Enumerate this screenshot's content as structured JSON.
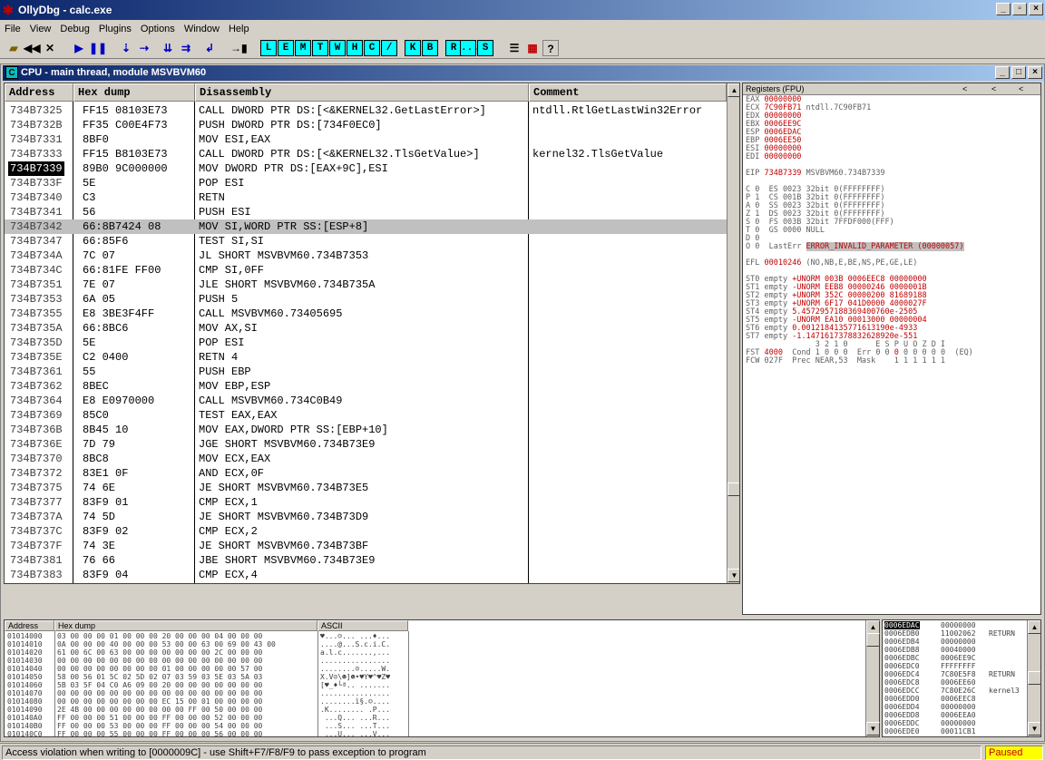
{
  "app": {
    "title": "OllyDbg - calc.exe"
  },
  "menu": [
    "File",
    "View",
    "Debug",
    "Plugins",
    "Options",
    "Window",
    "Help"
  ],
  "toolbar": {
    "letters": [
      "L",
      "E",
      "M",
      "T",
      "W",
      "H",
      "C",
      "/",
      "K",
      "B",
      "R",
      "...",
      "S"
    ]
  },
  "cpu": {
    "title": "CPU - main thread, module MSVBVM60"
  },
  "disasm": {
    "headers": [
      "Address",
      "Hex dump",
      "Disassembly",
      "Comment"
    ],
    "rows": [
      {
        "addr": "734B7325",
        "hex": "FF15 08103E73",
        "dis": "CALL DWORD PTR DS:[<&KERNEL32.GetLastError>]",
        "com": "ntdll.RtlGetLastWin32Error"
      },
      {
        "addr": "734B732B",
        "hex": "FF35 C00E4F73",
        "dis": "PUSH DWORD PTR DS:[734F0EC0]",
        "com": ""
      },
      {
        "addr": "734B7331",
        "hex": "8BF0",
        "dis": "MOV ESI,EAX",
        "com": ""
      },
      {
        "addr": "734B7333",
        "hex": "FF15 B8103E73",
        "dis": "CALL DWORD PTR DS:[<&KERNEL32.TlsGetValue>]",
        "com": "kernel32.TlsGetValue"
      },
      {
        "addr": "734B7339",
        "hex": "89B0 9C000000",
        "dis": "MOV DWORD PTR DS:[EAX+9C],ESI",
        "com": ""
      },
      {
        "addr": "734B733F",
        "hex": "5E",
        "dis": "POP ESI",
        "com": ""
      },
      {
        "addr": "734B7340",
        "hex": "C3",
        "dis": "RETN",
        "com": ""
      },
      {
        "addr": "734B7341",
        "hex": "56",
        "dis": "PUSH ESI",
        "com": ""
      },
      {
        "addr": "734B7342",
        "hex": "66:8B7424 08",
        "dis": "MOV SI,WORD PTR SS:[ESP+8]",
        "com": ""
      },
      {
        "addr": "734B7347",
        "hex": "66:85F6",
        "dis": "TEST SI,SI",
        "com": ""
      },
      {
        "addr": "734B734A",
        "hex": "7C 07",
        "dis": "JL SHORT MSVBVM60.734B7353",
        "com": ""
      },
      {
        "addr": "734B734C",
        "hex": "66:81FE FF00",
        "dis": "CMP SI,0FF",
        "com": ""
      },
      {
        "addr": "734B7351",
        "hex": "7E 07",
        "dis": "JLE SHORT MSVBVM60.734B735A",
        "com": ""
      },
      {
        "addr": "734B7353",
        "hex": "6A 05",
        "dis": "PUSH 5",
        "com": ""
      },
      {
        "addr": "734B7355",
        "hex": "E8 3BE3F4FF",
        "dis": "CALL MSVBVM60.73405695",
        "com": ""
      },
      {
        "addr": "734B735A",
        "hex": "66:8BC6",
        "dis": "MOV AX,SI",
        "com": ""
      },
      {
        "addr": "734B735D",
        "hex": "5E",
        "dis": "POP ESI",
        "com": ""
      },
      {
        "addr": "734B735E",
        "hex": "C2 0400",
        "dis": "RETN 4",
        "com": ""
      },
      {
        "addr": "734B7361",
        "hex": "55",
        "dis": "PUSH EBP",
        "com": ""
      },
      {
        "addr": "734B7362",
        "hex": "8BEC",
        "dis": "MOV EBP,ESP",
        "com": ""
      },
      {
        "addr": "734B7364",
        "hex": "E8 E0970000",
        "dis": "CALL MSVBVM60.734C0B49",
        "com": ""
      },
      {
        "addr": "734B7369",
        "hex": "85C0",
        "dis": "TEST EAX,EAX",
        "com": ""
      },
      {
        "addr": "734B736B",
        "hex": "8B45 10",
        "dis": "MOV EAX,DWORD PTR SS:[EBP+10]",
        "com": ""
      },
      {
        "addr": "734B736E",
        "hex": "7D 79",
        "dis": "JGE SHORT MSVBVM60.734B73E9",
        "com": ""
      },
      {
        "addr": "734B7370",
        "hex": "8BC8",
        "dis": "MOV ECX,EAX",
        "com": ""
      },
      {
        "addr": "734B7372",
        "hex": "83E1 0F",
        "dis": "AND ECX,0F",
        "com": ""
      },
      {
        "addr": "734B7375",
        "hex": "74 6E",
        "dis": "JE SHORT MSVBVM60.734B73E5",
        "com": ""
      },
      {
        "addr": "734B7377",
        "hex": "83F9 01",
        "dis": "CMP ECX,1",
        "com": ""
      },
      {
        "addr": "734B737A",
        "hex": "74 5D",
        "dis": "JE SHORT MSVBVM60.734B73D9",
        "com": ""
      },
      {
        "addr": "734B737C",
        "hex": "83F9 02",
        "dis": "CMP ECX,2",
        "com": ""
      },
      {
        "addr": "734B737F",
        "hex": "74 3E",
        "dis": "JE SHORT MSVBVM60.734B73BF",
        "com": ""
      },
      {
        "addr": "734B7381",
        "hex": "76 66",
        "dis": "JBE SHORT MSVBVM60.734B73E9",
        "com": ""
      },
      {
        "addr": "734B7383",
        "hex": "83F9 04",
        "dis": "CMP ECX,4",
        "com": ""
      }
    ]
  },
  "registers": {
    "title": "Registers (FPU)",
    "nav": [
      "<",
      "<",
      "<"
    ],
    "lines": [
      [
        {
          "t": "EAX ",
          "c": "g"
        },
        {
          "t": "00000000",
          "c": "r"
        }
      ],
      [
        {
          "t": "ECX ",
          "c": "g"
        },
        {
          "t": "7C90FB71",
          "c": "r"
        },
        {
          "t": " ntdll.7C90FB71",
          "c": "g"
        }
      ],
      [
        {
          "t": "EDX ",
          "c": "g"
        },
        {
          "t": "00000000",
          "c": "r"
        }
      ],
      [
        {
          "t": "EBX ",
          "c": "g"
        },
        {
          "t": "0006EE9C",
          "c": "r"
        }
      ],
      [
        {
          "t": "ESP ",
          "c": "g"
        },
        {
          "t": "0006EDAC",
          "c": "r"
        }
      ],
      [
        {
          "t": "EBP ",
          "c": "g"
        },
        {
          "t": "0006EE50",
          "c": "r"
        }
      ],
      [
        {
          "t": "ESI ",
          "c": "g"
        },
        {
          "t": "00000000",
          "c": "r"
        }
      ],
      [
        {
          "t": "EDI ",
          "c": "g"
        },
        {
          "t": "00000000",
          "c": "r"
        }
      ],
      [
        {
          "t": "",
          "c": "g"
        }
      ],
      [
        {
          "t": "EIP ",
          "c": "g"
        },
        {
          "t": "734B7339",
          "c": "r"
        },
        {
          "t": " MSVBVM60.734B7339",
          "c": "g"
        }
      ],
      [
        {
          "t": "",
          "c": "g"
        }
      ],
      [
        {
          "t": "C 0  ES 0023 32bit 0(FFFFFFFF)",
          "c": "g"
        }
      ],
      [
        {
          "t": "P 1  CS 001B 32bit 0(FFFFFFFF)",
          "c": "g"
        }
      ],
      [
        {
          "t": "A 0  SS 0023 32bit 0(FFFFFFFF)",
          "c": "g"
        }
      ],
      [
        {
          "t": "Z 1  DS 0023 32bit 0(FFFFFFFF)",
          "c": "g"
        }
      ],
      [
        {
          "t": "S 0  FS 003B 32bit 7FFDF000(FFF)",
          "c": "g"
        }
      ],
      [
        {
          "t": "T 0  GS 0000 NULL",
          "c": "g"
        }
      ],
      [
        {
          "t": "D 0",
          "c": "g"
        }
      ],
      [
        {
          "t": "O 0  LastErr ",
          "c": "g"
        },
        {
          "t": "ERROR_INVALID_PARAMETER (00000057)",
          "c": "h"
        }
      ],
      [
        {
          "t": "",
          "c": "g"
        }
      ],
      [
        {
          "t": "EFL ",
          "c": "g"
        },
        {
          "t": "00010246",
          "c": "r"
        },
        {
          "t": " (NO,NB,E,BE,NS,PE,GE,LE)",
          "c": "g"
        }
      ],
      [
        {
          "t": "",
          "c": "g"
        }
      ],
      [
        {
          "t": "ST0 empty ",
          "c": "g"
        },
        {
          "t": "+UNORM 003B 0006EEC8 00000000",
          "c": "r"
        }
      ],
      [
        {
          "t": "ST1 empty ",
          "c": "g"
        },
        {
          "t": "-UNORM EEB8 00000246 0000001B",
          "c": "r"
        }
      ],
      [
        {
          "t": "ST2 empty ",
          "c": "g"
        },
        {
          "t": "+UNORM 352C 00000200 81689188",
          "c": "r"
        }
      ],
      [
        {
          "t": "ST3 empty ",
          "c": "g"
        },
        {
          "t": "+UNORM 6F17 041D0000 4000027F",
          "c": "r"
        }
      ],
      [
        {
          "t": "ST4 empty ",
          "c": "g"
        },
        {
          "t": "5.4572957188369400760e-2505",
          "c": "r"
        }
      ],
      [
        {
          "t": "ST5 empty ",
          "c": "g"
        },
        {
          "t": "-UNORM EA10 00013000 00000004",
          "c": "r"
        }
      ],
      [
        {
          "t": "ST6 empty ",
          "c": "g"
        },
        {
          "t": "0.0012184135771613190e-4933",
          "c": "r"
        }
      ],
      [
        {
          "t": "ST7 empty ",
          "c": "g"
        },
        {
          "t": "-1.1471617378832628920e-551",
          "c": "r"
        }
      ],
      [
        {
          "t": "               3 2 1 0      E S P U O Z D I",
          "c": "g"
        }
      ],
      [
        {
          "t": "FST ",
          "c": "g"
        },
        {
          "t": "4000",
          "c": "r"
        },
        {
          "t": "  Cond 1 0 0 0  Err 0 0 ",
          "c": "g"
        },
        {
          "t": "0",
          "c": "r"
        },
        {
          "t": " 0 0 0 0 0  (EQ)",
          "c": "g"
        }
      ],
      [
        {
          "t": "FCW 027F  Prec NEAR,53  Mask    1 1 1 1 1 1",
          "c": "g"
        }
      ]
    ]
  },
  "dump": {
    "headers": [
      "Address",
      "Hex dump",
      "ASCII"
    ],
    "rows": [
      {
        "a": "01014000",
        "h": "03 00 00 00 01 00 00 00 20 00 00 00 04 00 00 00",
        "s": "♥...☺... ...♦..."
      },
      {
        "a": "01014010",
        "h": "0A 00 00 00 40 00 00 00 53 00 00 63 00 69 00 43 00",
        "s": "....@...S.c.i.C."
      },
      {
        "a": "01014020",
        "h": "61 00 6C 00 63 00 00 00 00 00 00 00 2C 00 00 00",
        "s": "a.l.c.......,..."
      },
      {
        "a": "01014030",
        "h": "00 00 00 00 00 00 00 00 00 00 00 00 00 00 00 00",
        "s": "................"
      },
      {
        "a": "01014040",
        "h": "00 00 00 00 00 00 00 00 01 00 00 00 00 00 57 00",
        "s": "........☺.....W."
      },
      {
        "a": "01014050",
        "h": "58 00 56 01 5C 02 5D 02 07 03 59 03 5E 03 5A 03",
        "s": "X.V☺\\☻]☻•♥Y♥^♥Z♥"
      },
      {
        "a": "01014060",
        "h": "5B 03 5F 04 C0 A6 09 00 20 00 00 00 00 00 00 00",
        "s": "[♥_♦└ª.. ......."
      },
      {
        "a": "01014070",
        "h": "00 00 00 00 00 00 00 00 00 00 00 00 00 00 00 00",
        "s": "................"
      },
      {
        "a": "01014080",
        "h": "00 00 00 00 00 00 00 00 EC 15 00 01 00 00 00 00",
        "s": "........ì§.☺...."
      },
      {
        "a": "01014090",
        "h": "2E 4B 00 00 00 00 00 00 00 00 FF 00 50 00 00 00",
        "s": ".K........ .P..."
      },
      {
        "a": "010140A0",
        "h": "FF 00 00 00 51 00 00 00 FF 00 00 00 52 00 00 00",
        "s": " ...Q... ...R..."
      },
      {
        "a": "010140B0",
        "h": "FF 00 00 00 53 00 00 00 FF 00 00 00 54 00 00 00",
        "s": " ...S... ...T..."
      },
      {
        "a": "010140C0",
        "h": "FF 00 00 00 55 00 00 00 FF 00 00 00 56 00 00 00",
        "s": " ...U... ...V..."
      }
    ]
  },
  "stack": {
    "rows": [
      {
        "a": "0006EDAC",
        "v": "00000000",
        "c": ""
      },
      {
        "a": "0006EDB0",
        "v": "11002062",
        "c": "RETURN"
      },
      {
        "a": "0006EDB4",
        "v": "00000000",
        "c": ""
      },
      {
        "a": "0006EDB8",
        "v": "00040000",
        "c": ""
      },
      {
        "a": "0006EDBC",
        "v": "0006EE9C",
        "c": ""
      },
      {
        "a": "0006EDC0",
        "v": "FFFFFFFF",
        "c": ""
      },
      {
        "a": "0006EDC4",
        "v": "7C80E5F8",
        "c": "RETURN"
      },
      {
        "a": "0006EDC8",
        "v": "0006EE60",
        "c": ""
      },
      {
        "a": "0006EDCC",
        "v": "7C80E26C",
        "c": "kernel3"
      },
      {
        "a": "0006EDD0",
        "v": "0006EEC8",
        "c": ""
      },
      {
        "a": "0006EDD4",
        "v": "00000000",
        "c": ""
      },
      {
        "a": "0006EDD8",
        "v": "0006EEA0",
        "c": ""
      },
      {
        "a": "0006EDDC",
        "v": "00000000",
        "c": ""
      },
      {
        "a": "0006EDE0",
        "v": "00011CB1",
        "c": ""
      }
    ]
  },
  "status": {
    "message": "Access violation when writing to [0000009C] - use Shift+F7/F8/F9 to pass exception to program",
    "state": "Paused"
  },
  "colors": {
    "title_bar": "#0a246a",
    "selected_row": "#c0c0c0",
    "register_changed": "#c00000",
    "paused_bg": "#ffff00"
  }
}
